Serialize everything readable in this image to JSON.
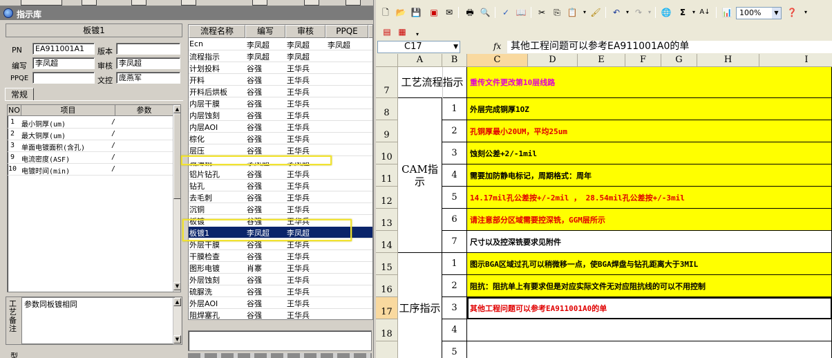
{
  "left_app": {
    "window_title": "指示库",
    "pane_title": "板镀1",
    "fields": {
      "pn_label": "PN",
      "pn_value": "EA911001A1",
      "version_label": "版本",
      "version_value": "",
      "writer_label": "编写",
      "writer_value": "李凤超",
      "reviewer_label": "审核",
      "reviewer_value": "李凤超",
      "ppqe_label": "PPQE",
      "ppqe_value": "",
      "doc_control_label": "文控",
      "doc_control_value": "庞燕军"
    },
    "tab_label": "常规",
    "params": {
      "headers": [
        "NO",
        "项目",
        "参数"
      ],
      "rows": [
        {
          "no": "1",
          "item": "最小铜厚(um)",
          "value": "/"
        },
        {
          "no": "2",
          "item": "最大铜厚(um)",
          "value": "/"
        },
        {
          "no": "3",
          "item": "单面电镀面积(含孔)",
          "value": "/"
        },
        {
          "no": "9",
          "item": "电流密度(ASF)",
          "value": "/"
        },
        {
          "no": "10",
          "item": "电镀时间(min)",
          "value": "/"
        }
      ]
    },
    "remark_label": "工艺备注",
    "remark_text": "参数同板镀相同",
    "bottom_label": "型",
    "process_grid": {
      "headers": [
        "流程名称",
        "编写",
        "审核",
        "PPQE"
      ],
      "rows": [
        {
          "name": "Ecn",
          "writer": "李凤超",
          "reviewer": "李凤超",
          "ppqe": "李凤超"
        },
        {
          "name": "流程指示",
          "writer": "李凤超",
          "reviewer": "李凤超",
          "ppqe": ""
        },
        {
          "name": "计划投料",
          "writer": "谷强",
          "reviewer": "王华兵",
          "ppqe": ""
        },
        {
          "name": "开料",
          "writer": "谷强",
          "reviewer": "王华兵",
          "ppqe": ""
        },
        {
          "name": "开料后烘板",
          "writer": "谷强",
          "reviewer": "王华兵",
          "ppqe": ""
        },
        {
          "name": "内层干膜",
          "writer": "谷强",
          "reviewer": "王华兵",
          "ppqe": ""
        },
        {
          "name": "内层蚀刻",
          "writer": "谷强",
          "reviewer": "王华兵",
          "ppqe": ""
        },
        {
          "name": "内层AOI",
          "writer": "谷强",
          "reviewer": "王华兵",
          "ppqe": ""
        },
        {
          "name": "棕化",
          "writer": "谷强",
          "reviewer": "王华兵",
          "ppqe": ""
        },
        {
          "name": "层压",
          "writer": "谷强",
          "reviewer": "王华兵",
          "ppqe": ""
        },
        {
          "name": "减薄铜",
          "writer": "李凤超",
          "reviewer": "李凤超",
          "ppqe": ""
        },
        {
          "name": "铝片钻孔",
          "writer": "谷强",
          "reviewer": "王华兵",
          "ppqe": ""
        },
        {
          "name": "钻孔",
          "writer": "谷强",
          "reviewer": "王华兵",
          "ppqe": ""
        },
        {
          "name": "去毛刺",
          "writer": "谷强",
          "reviewer": "王华兵",
          "ppqe": ""
        },
        {
          "name": "沉铜",
          "writer": "谷强",
          "reviewer": "王华兵",
          "ppqe": ""
        },
        {
          "name": "板镀",
          "writer": "谷强",
          "reviewer": "王华兵",
          "ppqe": ""
        },
        {
          "name": "板镀1",
          "writer": "李凤超",
          "reviewer": "李凤超",
          "ppqe": ""
        },
        {
          "name": "外层干膜",
          "writer": "谷强",
          "reviewer": "王华兵",
          "ppqe": ""
        },
        {
          "name": "干膜检查",
          "writer": "谷强",
          "reviewer": "王华兵",
          "ppqe": ""
        },
        {
          "name": "图形电镀",
          "writer": "肖寨",
          "reviewer": "王华兵",
          "ppqe": ""
        },
        {
          "name": "外层蚀刻",
          "writer": "谷强",
          "reviewer": "王华兵",
          "ppqe": ""
        },
        {
          "name": "硫脲洗",
          "writer": "谷强",
          "reviewer": "王华兵",
          "ppqe": ""
        },
        {
          "name": "外层AOI",
          "writer": "谷强",
          "reviewer": "王华兵",
          "ppqe": ""
        },
        {
          "name": "阻焊塞孔",
          "writer": "谷强",
          "reviewer": "王华兵",
          "ppqe": ""
        }
      ]
    },
    "highlight_color": "#f2e330",
    "selection_color": "#0a246a"
  },
  "excel": {
    "zoom": "100%",
    "name_box": "C17",
    "formula": "其他工程问题可以参考EA911001A0的单",
    "columns": [
      "A",
      "B",
      "C",
      "D",
      "E",
      "F",
      "G",
      "H",
      "I"
    ],
    "row_numbers": [
      "7",
      "8",
      "9",
      "10",
      "11",
      "12",
      "13",
      "14",
      "15",
      "16",
      "17",
      "18"
    ],
    "labels": {
      "process_flow": "工艺流程指示",
      "cam": "CAM指示",
      "procedure": "工序指示"
    },
    "row7_text": "重传文件更改第10层线路",
    "cam_items": [
      {
        "no": "1",
        "text": "外层完成铜厚1OZ",
        "style": "black"
      },
      {
        "no": "2",
        "text": "孔铜厚最小20UM，平均25um",
        "style": "red"
      },
      {
        "no": "3",
        "text": "蚀刻公差+2/-1mil",
        "style": "black"
      },
      {
        "no": "4",
        "text": "需要加防静电标记，周期格式：周年",
        "style": "black"
      },
      {
        "no": "5",
        "text": "14.17mil孔公差按+/-2mil  ，  28.54mil孔公差按+/-3mil",
        "style": "red"
      },
      {
        "no": "6",
        "text": "请注意部分区域需要控深铣，GGM层所示",
        "style": "red"
      },
      {
        "no": "7",
        "text": "尺寸以及控深铣要求见附件",
        "style": "black"
      }
    ],
    "procedure_items": [
      {
        "no": "1",
        "text": "图示BGA区域过孔可以稍微移一点，使BGA焊盘与钻孔距离大于3MIL",
        "style": "black"
      },
      {
        "no": "2",
        "text": "阻抗：阻抗单上有要求但是对应实际文件无对应阻抗线的可以不用控制",
        "style": "black"
      },
      {
        "no": "3",
        "text": "其他工程问题可以参考EA911001A0的单",
        "style": "red"
      },
      {
        "no": "4",
        "text": "",
        "style": "black"
      },
      {
        "no": "5",
        "text": "",
        "style": "black"
      }
    ],
    "highlight_fill": "#ffff00"
  }
}
